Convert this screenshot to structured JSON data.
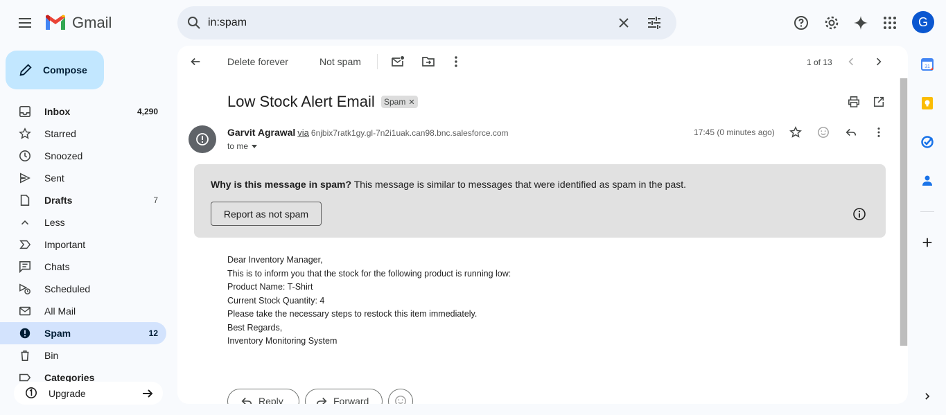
{
  "app": {
    "name": "Gmail"
  },
  "search": {
    "value": "in:spam"
  },
  "account": {
    "initial": "G"
  },
  "compose": {
    "label": "Compose"
  },
  "nav": [
    {
      "id": "inbox",
      "label": "Inbox",
      "count": "4,290",
      "icon": "inbox-icon",
      "bold": true
    },
    {
      "id": "starred",
      "label": "Starred",
      "count": "",
      "icon": "star-icon"
    },
    {
      "id": "snoozed",
      "label": "Snoozed",
      "count": "",
      "icon": "clock-icon"
    },
    {
      "id": "sent",
      "label": "Sent",
      "count": "",
      "icon": "send-icon"
    },
    {
      "id": "drafts",
      "label": "Drafts",
      "count": "7",
      "icon": "draft-icon",
      "bold": true
    },
    {
      "id": "less",
      "label": "Less",
      "count": "",
      "icon": "chevron-up-icon"
    },
    {
      "id": "important",
      "label": "Important",
      "count": "",
      "icon": "important-icon"
    },
    {
      "id": "chats",
      "label": "Chats",
      "count": "",
      "icon": "chat-icon"
    },
    {
      "id": "scheduled",
      "label": "Scheduled",
      "count": "",
      "icon": "scheduled-icon"
    },
    {
      "id": "allmail",
      "label": "All Mail",
      "count": "",
      "icon": "all-mail-icon"
    },
    {
      "id": "spam",
      "label": "Spam",
      "count": "12",
      "icon": "spam-icon",
      "active": true
    },
    {
      "id": "bin",
      "label": "Bin",
      "count": "",
      "icon": "trash-icon"
    },
    {
      "id": "categories",
      "label": "Categories",
      "count": "",
      "icon": "label-icon"
    }
  ],
  "upgrade": {
    "label": "Upgrade"
  },
  "toolbar": {
    "delete_forever": "Delete forever",
    "not_spam": "Not spam",
    "pager": "1 of 13"
  },
  "email": {
    "subject": "Low Stock Alert Email",
    "label_chip": "Spam",
    "sender_name": "Garvit Agrawal",
    "via": "via",
    "via_address": "6njbix7ratk1gy.gl-7n2i1uak.can98.bnc.salesforce.com",
    "to": "to me",
    "time": "17:45 (0 minutes ago)",
    "spam_banner": {
      "question": "Why is this message in spam?",
      "explanation": " This message is similar to messages that were identified as spam in the past.",
      "report_button": "Report as not spam"
    },
    "body_lines": [
      "Dear Inventory Manager,",
      "This is to inform you that the stock for the following product is running low:",
      "Product Name: T-Shirt",
      "Current Stock Quantity: 4",
      "Please take the necessary steps to restock this item immediately.",
      "Best Regards,",
      "Inventory Monitoring System"
    ],
    "reply_label": "Reply",
    "forward_label": "Forward"
  },
  "colors": {
    "compose_bg": "#c2e7ff",
    "active_nav_bg": "#d3e3fd",
    "search_bg": "#e9eef6",
    "banner_bg": "#e1e1e1",
    "avatar_bg": "#0b57d0"
  }
}
